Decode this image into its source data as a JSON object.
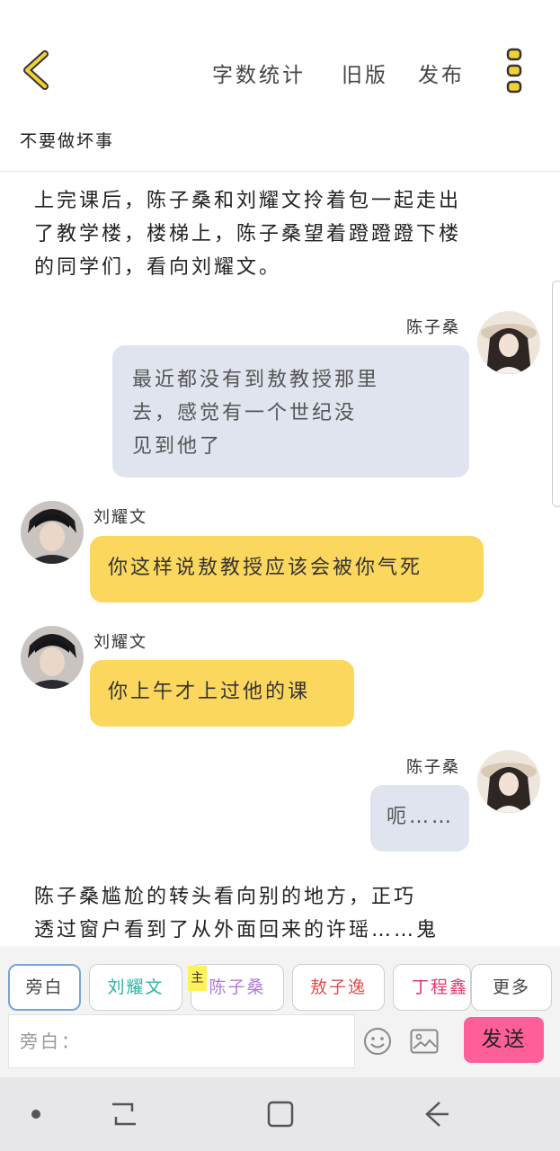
{
  "header": {
    "back_icon": "chevron-left-icon",
    "word_count_label": "字数统计",
    "old_version_label": "旧版",
    "publish_label": "发布",
    "more_icon": "vertical-dots-icon",
    "accent_color": "#f2d230"
  },
  "story": {
    "title": "不要做坏事"
  },
  "messages": [
    {
      "type": "narration",
      "text_lines": [
        "上完课后，陈子桑和刘耀文拎着包一起走出",
        "了教学楼，楼梯上，陈子桑望着蹬蹬蹬下楼",
        "的同学们，看向刘耀文。"
      ]
    },
    {
      "type": "right",
      "speaker": "陈子桑",
      "text_lines": [
        "最近都没有到敖教授那里",
        "去，感觉有一个世纪没",
        "见到他了"
      ]
    },
    {
      "type": "left",
      "speaker": "刘耀文",
      "text_lines": [
        "你这样说敖教授应该会被你气死"
      ]
    },
    {
      "type": "left",
      "speaker": "刘耀文",
      "text_lines": [
        "你上午才上过他的课"
      ]
    },
    {
      "type": "right",
      "speaker": "陈子桑",
      "text_lines": [
        "呃……"
      ]
    },
    {
      "type": "narration",
      "text_lines": [
        "陈子桑尴尬的转头看向别的地方，正巧",
        "透过窗户看到了从外面回来的许瑶……鬼"
      ]
    }
  ],
  "characters": {
    "tabs": [
      {
        "label": "旁白",
        "color": "#444444"
      },
      {
        "label": "刘耀文",
        "color": "#2bb3a3"
      },
      {
        "label": "陈子桑",
        "color": "#b07ad9"
      },
      {
        "label": "敖子逸",
        "color": "#e04f4f"
      },
      {
        "label": "丁程鑫",
        "color": "#e03a6a"
      }
    ],
    "more_label": "更多",
    "main_badge": "主"
  },
  "composer": {
    "placeholder": "旁白：",
    "emoji_icon": "smiley-icon",
    "image_icon": "image-icon",
    "send_label": "发送",
    "send_color": "#ff5f98"
  },
  "system_nav": {
    "icons": [
      "dot-icon",
      "recent-apps-icon",
      "home-icon",
      "back-arrow-icon"
    ]
  }
}
